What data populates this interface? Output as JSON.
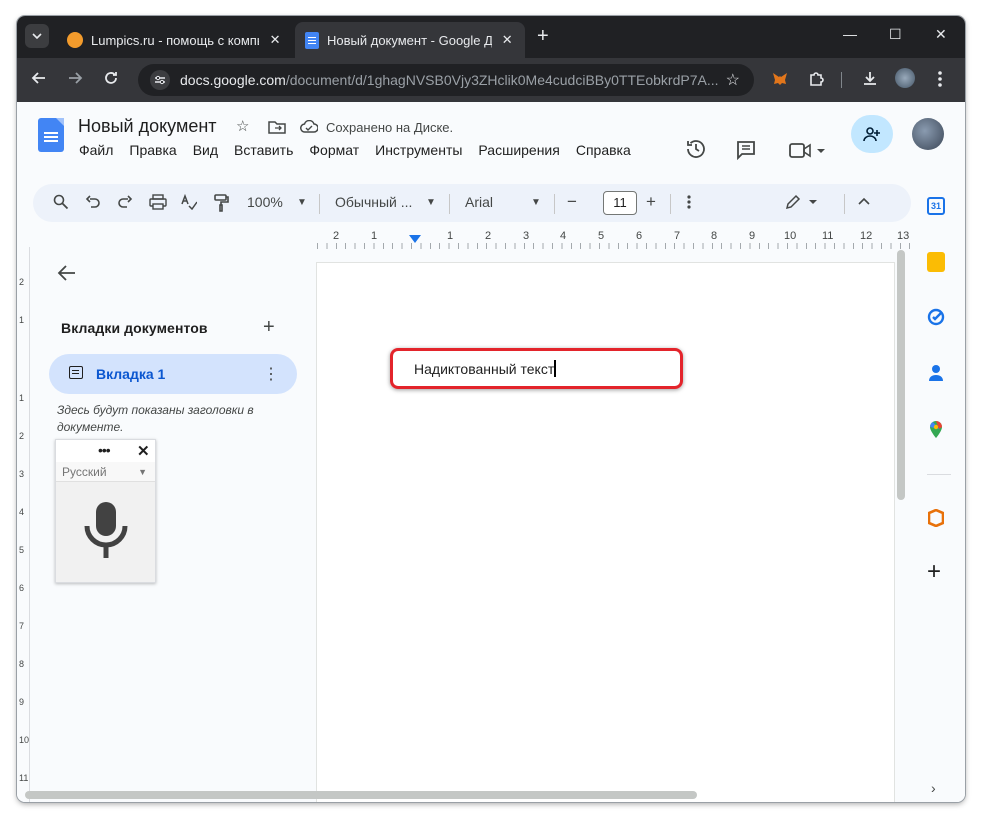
{
  "browser": {
    "tabs": [
      {
        "title": "Lumpics.ru - помощь с компьютером",
        "close": "✕"
      },
      {
        "title": "Новый документ - Google Документы",
        "close": "✕"
      }
    ],
    "new_tab": "+",
    "window_controls": {
      "minimize": "—",
      "maximize": "☐",
      "close": "✕"
    },
    "url_domain": "docs.google.com",
    "url_path": "/document/d/1ghagNVSB0Vjy3ZHclik0Me4cudciBBy0TTEobkrdP7A...",
    "icons": [
      "back-icon",
      "forward-icon",
      "reload-icon",
      "site-info-icon",
      "bookmark-star-icon",
      "metamask-extension-icon",
      "extensions-icon",
      "download-icon",
      "profile-avatar-icon",
      "chrome-menu-icon"
    ]
  },
  "docs": {
    "title": "Новый документ",
    "saved_status": "Сохранено на Диске.",
    "menu": [
      "Файл",
      "Правка",
      "Вид",
      "Вставить",
      "Формат",
      "Инструменты",
      "Расширения",
      "Справка"
    ],
    "toolbar": {
      "zoom": "100%",
      "style": "Обычный ...",
      "font": "Arial",
      "font_size": "11",
      "minus": "−",
      "plus": "+"
    },
    "ruler_top": [
      "2",
      "1",
      "1",
      "2",
      "3",
      "4",
      "5",
      "6",
      "7",
      "8",
      "9",
      "10",
      "11",
      "12",
      "13"
    ],
    "ruler_left": [
      "2",
      "1",
      "1",
      "2",
      "3",
      "4",
      "5",
      "6",
      "7",
      "8",
      "9",
      "10",
      "11"
    ]
  },
  "tabs_panel": {
    "heading": "Вкладки документов",
    "add": "+",
    "tab_label": "Вкладка 1",
    "more": "⋮",
    "hint": "Здесь будут показаны заголовки в документе."
  },
  "voice_typing": {
    "dots": "•••",
    "close": "✕",
    "language": "Русский"
  },
  "document": {
    "text": "Надиктованный текст"
  },
  "side_panel": {
    "calendar_day": "31",
    "add": "+",
    "expand": "›"
  },
  "colors": {
    "accent": "#0b57d0",
    "highlight_border": "#e3242b",
    "tab_active_bg": "#d3e3fd",
    "share_bg": "#c2e7ff"
  }
}
